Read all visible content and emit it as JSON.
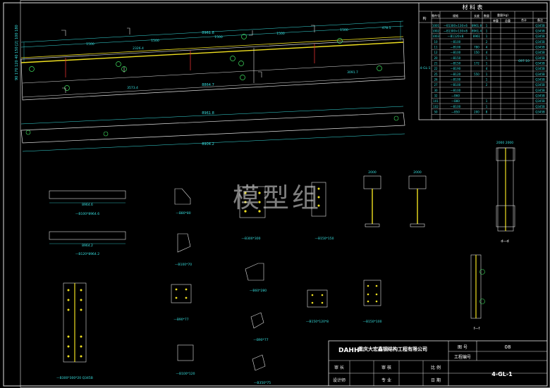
{
  "watermark": "模型组",
  "material_table": {
    "title": "材 料 表",
    "headers": [
      "构",
      "零件号",
      "规格",
      "长度",
      "数量",
      "重量(kg)",
      "合计",
      "备注"
    ],
    "subheaders": [
      "单重",
      "总重"
    ],
    "rows": [
      [
        "1001",
        "—B1300×130×6",
        "8961.8",
        "1",
        "",
        "",
        "Q345B"
      ],
      [
        "1002",
        "—B1300×130×8",
        "8961.4",
        "1",
        "",
        "",
        "Q345B"
      ],
      [
        "1003",
        "—B1120×8",
        "8961",
        "1",
        "",
        "",
        "Q345B"
      ],
      [
        "10",
        "—B100",
        "",
        "2",
        "",
        "",
        "Q345B"
      ],
      [
        "11",
        "—B100",
        "780",
        "4",
        "",
        "",
        "Q345B"
      ],
      [
        "12",
        "—B100",
        "150",
        "4",
        "",
        "",
        "Q345B"
      ],
      [
        "20",
        "—B150",
        "",
        "1",
        "",
        "",
        "Q345B"
      ],
      [
        "21",
        "—B150",
        "172",
        "1",
        "",
        "",
        "Q345B"
      ],
      [
        "22",
        "—B190",
        "",
        "4",
        "",
        "",
        "Q345B"
      ],
      [
        "25",
        "—B120",
        "550",
        "1",
        "",
        "",
        "Q345B"
      ],
      [
        "26",
        "—B100",
        "",
        "1",
        "",
        "",
        "Q345B"
      ],
      [
        "27",
        "—B100",
        "",
        "2",
        "",
        "",
        "Q345B"
      ],
      [
        "30",
        "—B100",
        "",
        "",
        "",
        "",
        "Q345B"
      ],
      [
        "32",
        "—B60",
        "",
        "",
        "",
        "",
        "Q345B"
      ],
      [
        "101",
        "—B80",
        "",
        "1",
        "",
        "",
        "Q345B"
      ],
      [
        "102",
        "—B100",
        "",
        "1",
        "",
        "",
        "Q345B"
      ],
      [
        "50",
        "—B50",
        "200",
        "8",
        "",
        "",
        "Q345B"
      ],
      [
        "",
        "",
        "",
        "",
        "",
        "",
        ""
      ]
    ],
    "member_label": "4-GL-1",
    "total": "697.10"
  },
  "beam": {
    "top_dims": [
      "8961.8"
    ],
    "sub_dims": [
      "1500",
      "1500",
      "1500",
      "1500",
      "1500",
      "478.5"
    ],
    "inner_dims": [
      "2326.4",
      "3573.4",
      "3091.7"
    ],
    "bottom_dims": [
      "8864.7"
    ],
    "bottom_plate_dims": [
      "8961.8",
      "8904.2"
    ],
    "left_dims": "90 170 120 40 150 [2] 100 180"
  },
  "details": {
    "plate1": "—B100*8964.6",
    "plate2": "—B120*8964.2",
    "part_a": "—B80*80",
    "part_b": "—B100*70",
    "part_c": "—B300*300",
    "part_d": "—B150*150",
    "part_e": "—B60*280",
    "part_f": "—B90*77",
    "part_g": "—B300*300*20  Q345B",
    "part_h": "—B100*120",
    "part_i": "—B120*100",
    "part_j": "—B350*75",
    "part_k": "—B200*200",
    "part_l": "—B150*120*8",
    "part_m": "—B150*100",
    "part_n": "—B120*70",
    "section_dd": "d—d",
    "section_ff": "f—f",
    "dim_2000": "2000 2000",
    "dim_360": "360"
  },
  "title_block": {
    "company": "重庆大宏鑫钢结构工程有限公司",
    "logo": "DAHH",
    "drawing_no_label": "图  号",
    "drawing_no": "08",
    "project_no_label": "工程编号",
    "row2": [
      "审 长",
      "审 核",
      "比 例"
    ],
    "row3": [
      "设计师",
      "专 业",
      "日 期"
    ],
    "member": "4-GL-1"
  }
}
